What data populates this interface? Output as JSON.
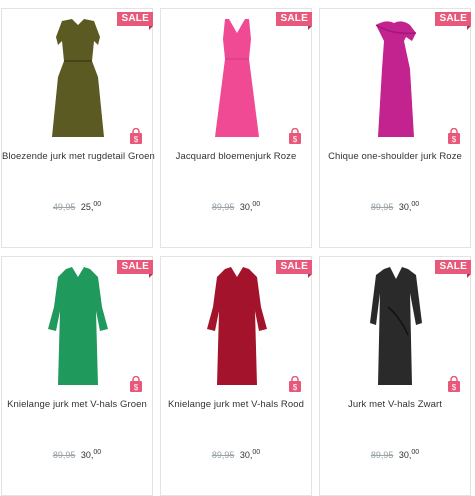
{
  "products": [
    {
      "badge": "SALE",
      "name": "Bloezende jurk met rugdetail Groen",
      "old_price": "49,95",
      "price_int": "25",
      "price_dec": "00",
      "color": "#5a5a22",
      "style": "sleeve"
    },
    {
      "badge": "SALE",
      "name": "Jacquard bloemenjurk Roze",
      "old_price": "89,95",
      "price_int": "30",
      "price_dec": "00",
      "color": "#ef4a93",
      "style": "vneck"
    },
    {
      "badge": "SALE",
      "name": "Chique one-shoulder jurk Roze",
      "old_price": "89,95",
      "price_int": "30",
      "price_dec": "00",
      "color": "#c2238f",
      "style": "oneshoulder"
    },
    {
      "badge": "SALE",
      "name": "Knielange jurk met V-hals Groen",
      "old_price": "89,95",
      "price_int": "30",
      "price_dec": "00",
      "color": "#1f9a5c",
      "style": "flutter"
    },
    {
      "badge": "SALE",
      "name": "Knielange jurk met V-hals Rood",
      "old_price": "89,95",
      "price_int": "30",
      "price_dec": "00",
      "color": "#a3142c",
      "style": "flutter"
    },
    {
      "badge": "SALE",
      "name": "Jurk met V-hals Zwart",
      "old_price": "89,95",
      "price_int": "30",
      "price_dec": "00",
      "color": "#2a2a2a",
      "style": "wrap"
    }
  ],
  "icons": {
    "bag": "shopping-bag-icon"
  },
  "colors": {
    "badge": "#e8587a",
    "bag": "#e8587a",
    "strike": "#9aa3a8"
  }
}
